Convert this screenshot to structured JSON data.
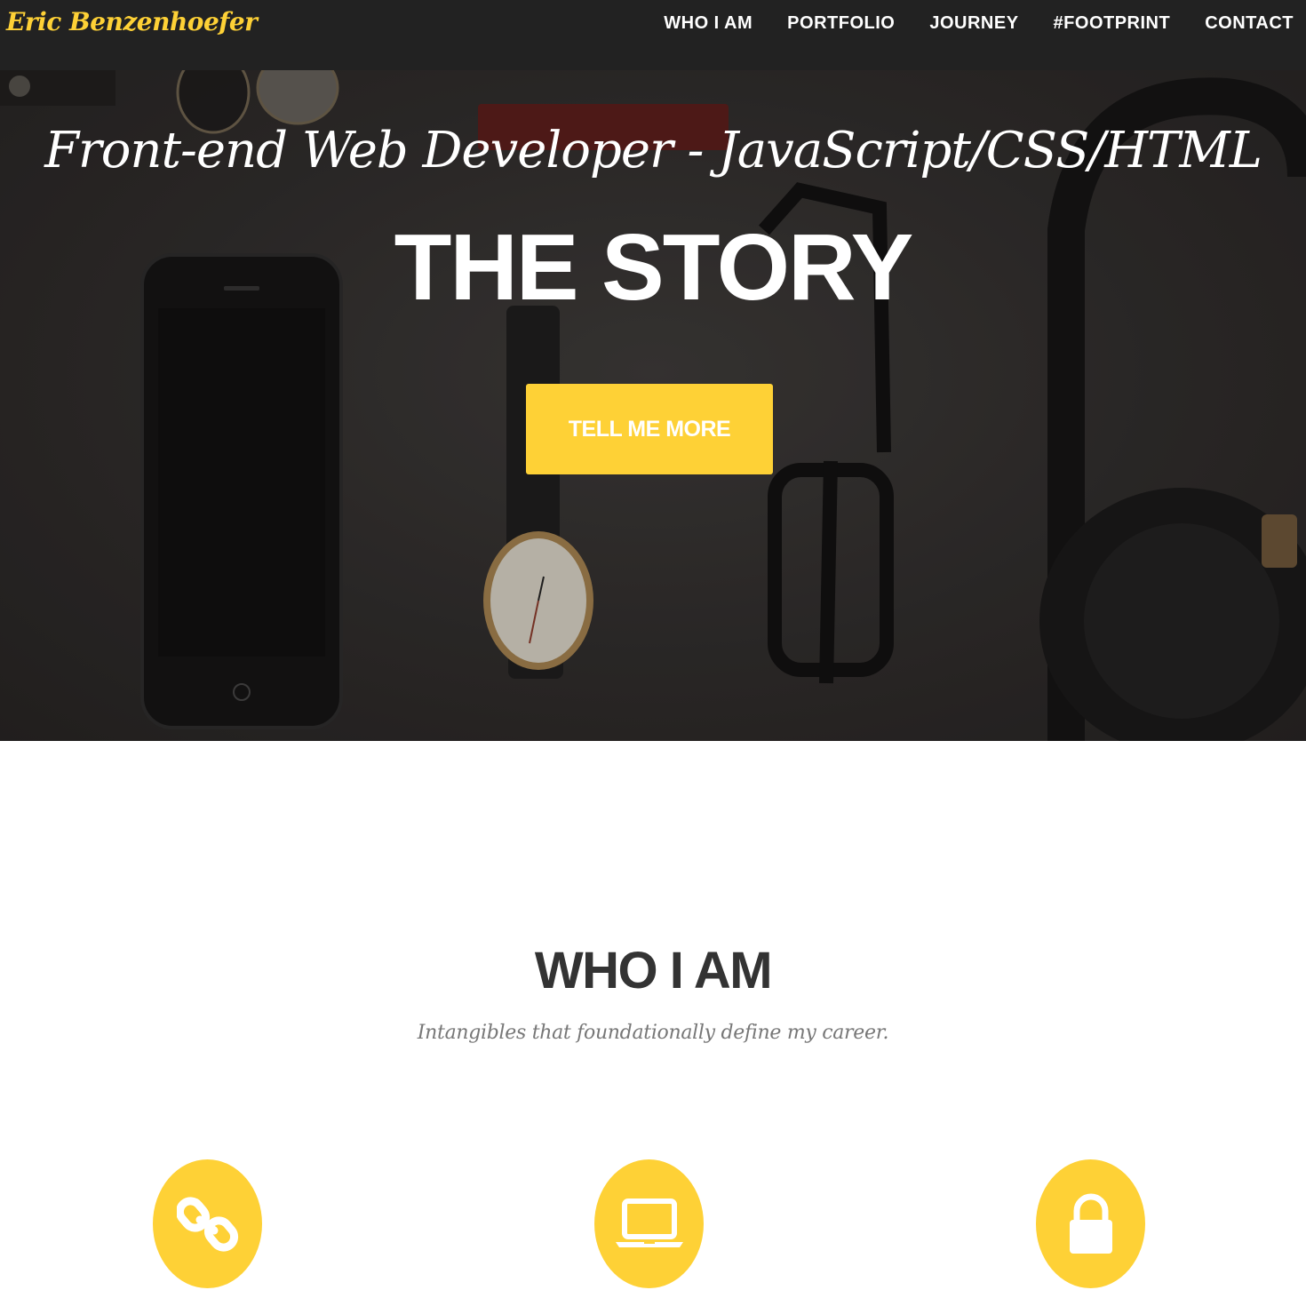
{
  "navbar": {
    "brand": "Eric Benzenhoefer",
    "links": [
      {
        "label": "WHO I AM"
      },
      {
        "label": "PORTFOLIO"
      },
      {
        "label": "JOURNEY"
      },
      {
        "label": "#FOOTPRINT"
      },
      {
        "label": "CONTACT"
      }
    ]
  },
  "hero": {
    "subtitle": "Front-end Web Developer - JavaScript/CSS/HTML",
    "title": "THE STORY",
    "button_label": "TELL ME MORE"
  },
  "about": {
    "heading": "WHO I AM",
    "subheading": "Intangibles that foundationally define my career.",
    "services": [
      {
        "icon": "link-icon"
      },
      {
        "icon": "laptop-icon"
      },
      {
        "icon": "lock-icon"
      }
    ]
  },
  "colors": {
    "accent": "#fed136",
    "navbar_bg": "#222222",
    "heading_text": "#333333",
    "muted_text": "#777777"
  }
}
